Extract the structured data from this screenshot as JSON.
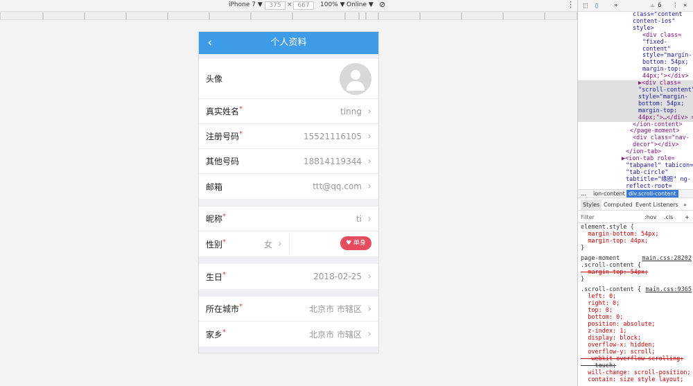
{
  "devtools_toolbar": {
    "device": "iPhone 7 ▼",
    "width": "375",
    "times": "×",
    "height": "667",
    "zoom": "100% ▼",
    "network": "Online ▼"
  },
  "app": {
    "title": "个人资料",
    "back_icon": "‹",
    "rows": {
      "avatar": {
        "label": "头像"
      },
      "realname": {
        "label": "真实姓名",
        "req": "*",
        "value": "tinng"
      },
      "regphone": {
        "label": "注册号码",
        "req": "*",
        "value": "15521116105"
      },
      "otherphone": {
        "label": "其他号码",
        "value": "18814119344"
      },
      "email": {
        "label": "邮箱",
        "value": "ttt@qq.com"
      },
      "nickname": {
        "label": "昵称",
        "req": "*",
        "value": "ti"
      },
      "gender": {
        "label": "性别",
        "req": "*",
        "value": "女",
        "badge": "♥ 单身"
      },
      "birthday": {
        "label": "生日",
        "req": "*",
        "value": "2018-02-25"
      },
      "city": {
        "label": "所在城市",
        "req": "*",
        "value": "北京市 市辖区"
      },
      "hometown": {
        "label": "家乡",
        "req": "*",
        "value": "北京市 市辖区"
      }
    },
    "chevron": "›"
  },
  "devtools_panel": {
    "top_tabs": {
      "more": "»",
      "warnings": "⚠ 6",
      "menu": "⋮",
      "close": "✕"
    },
    "dom": [
      "class=\"content",
      "content-ios\"",
      "style>",
      "<div class=",
      "\"fixed-",
      "content\"",
      "style=\"margin-",
      "bottom: 54px;",
      "margin-top:",
      "44px;\"></div>",
      "▶<div class=",
      "\"scroll-content\"",
      "style=\"margin-",
      "bottom: 54px;",
      "margin-top:",
      "44px;\">…</div> ==",
      "</ion-content>",
      "</page-moment>",
      "<div class=\"nav-",
      "decor\"></div>",
      "</ion-tab>",
      "▶<ion-tab role=",
      "\"tabpanel\" tabicon=",
      "\"tab-circle\"",
      "tabtitle=\"缘圈\" ng-",
      "reflect-root="
    ],
    "breadcrumbs": {
      "dots": "...",
      "parent": "ion-content",
      "selected": "div.scroll-content"
    },
    "tabs": {
      "styles": "Styles",
      "computed": "Computed",
      "listeners": "Event Listeners",
      "more": "»"
    },
    "filter": {
      "placeholder": "Filter",
      "hov": ":hov",
      "cls": ".cls",
      "add": "+"
    },
    "styles": [
      "element.style {",
      "  margin-bottom: 54px;",
      "  margin-top: 44px;",
      "}",
      "page-moment",
      ".scroll-content {",
      "  margin-top: 54px;",
      "}",
      ".scroll-content {",
      "  left: 0;",
      "  right: 0;",
      "  top: 0;",
      "  bottom: 0;",
      "  position: absolute;",
      "  z-index: 1;",
      "  display: block;",
      "  overflow-x: hidden;",
      "  overflow-y: scroll;",
      "  -webkit-overflow-scrolling:",
      "    touch;",
      "  will-change: scroll-position;",
      "  contain: size style layout;"
    ],
    "links": {
      "main1": "main.css:28202",
      "main2": "main.css:9365"
    }
  }
}
